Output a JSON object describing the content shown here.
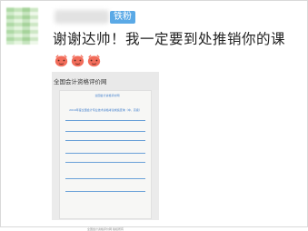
{
  "post": {
    "badge": "铁粉",
    "comment_text": "谢谢达帅！我一定要到处推销你的课",
    "emoji_name": "shy-face-emoji",
    "emoji_count_inline": 3,
    "emoji_count_next_line": 1
  },
  "attached_image": {
    "site_title": "全国会计资格评价网",
    "doc_heading": "全国会计资格评价网",
    "doc_subheading": "2019年度全国会计专业技术资格考试成绩查询（中、高级）",
    "footer": "全国会计资格评价网 版权所有"
  },
  "colors": {
    "badge_bg": "#5aa9e6",
    "link_blue": "#3a7acb"
  }
}
